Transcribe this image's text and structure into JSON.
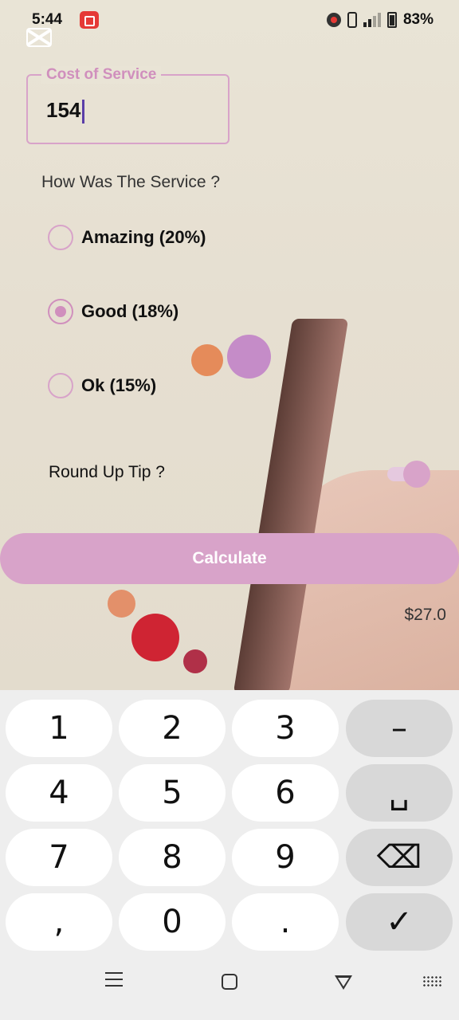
{
  "status_bar": {
    "time": "5:44",
    "battery": "83%",
    "icons": [
      "screen-record-icon",
      "record-dot-icon",
      "vibrate-icon",
      "signal-icon",
      "battery-icon"
    ]
  },
  "form": {
    "cost_label": "Cost of Service",
    "cost_value": "154",
    "question": "How Was The Service ?",
    "options": [
      {
        "label": "Amazing (20%)",
        "selected": false
      },
      {
        "label": "Good (18%)",
        "selected": true
      },
      {
        "label": "Ok (15%)",
        "selected": false
      }
    ],
    "round_up_label": "Round Up Tip ?",
    "round_up_on": true,
    "calculate_label": "Calculate",
    "result": "$27.0"
  },
  "keyboard": {
    "keys": [
      "1",
      "2",
      "3",
      "–",
      "4",
      "5",
      "6",
      "␣",
      "7",
      "8",
      "9",
      "⌫",
      ",",
      "0",
      ".",
      "✓"
    ]
  },
  "navbar": {
    "icons": [
      "menu-icon",
      "home-icon",
      "back-icon",
      "keyboard-icon"
    ]
  },
  "colors": {
    "accent": "#d8a3c9",
    "accent_text": "#d08fbd",
    "background": "#e9e4d6"
  }
}
